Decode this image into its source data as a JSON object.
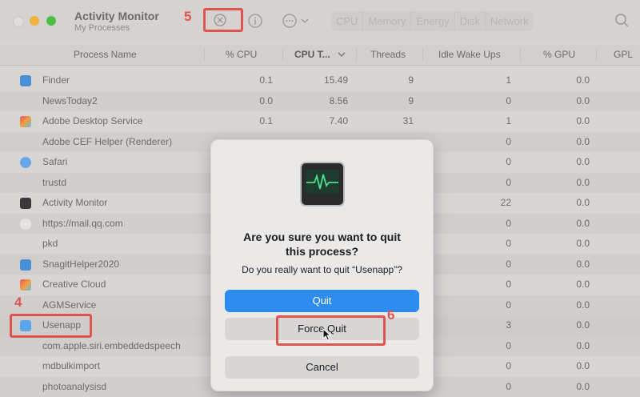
{
  "window": {
    "title": "Activity Monitor",
    "subtitle": "My Processes"
  },
  "toolbar": {
    "tabs": [
      "CPU",
      "Memory",
      "Energy",
      "Disk",
      "Network"
    ],
    "stop_icon": "stop-process-icon",
    "info_icon": "info-icon",
    "more_icon": "ellipsis-icon",
    "search_icon": "search-icon"
  },
  "table": {
    "columns": [
      "Process Name",
      "% CPU",
      "CPU T...",
      "Threads",
      "Idle Wake Ups",
      "% GPU",
      "GPL"
    ],
    "rows": [
      {
        "name": "Finder",
        "cpu": "0.1",
        "cpu_time": "15.49",
        "threads": "9",
        "idle": "1",
        "gpu": "0.0"
      },
      {
        "name": "NewsToday2",
        "cpu": "0.0",
        "cpu_time": "8.56",
        "threads": "9",
        "idle": "0",
        "gpu": "0.0"
      },
      {
        "name": "Adobe Desktop Service",
        "cpu": "0.1",
        "cpu_time": "7.40",
        "threads": "31",
        "idle": "1",
        "gpu": "0.0"
      },
      {
        "name": "Adobe CEF Helper (Renderer)",
        "cpu": "",
        "cpu_time": "",
        "threads": "",
        "idle": "0",
        "gpu": "0.0"
      },
      {
        "name": "Safari",
        "cpu": "",
        "cpu_time": "",
        "threads": "",
        "idle": "0",
        "gpu": "0.0"
      },
      {
        "name": "trustd",
        "cpu": "",
        "cpu_time": "",
        "threads": "",
        "idle": "0",
        "gpu": "0.0"
      },
      {
        "name": "Activity Monitor",
        "cpu": "",
        "cpu_time": "",
        "threads": "",
        "idle": "22",
        "gpu": "0.0"
      },
      {
        "name": "https://mail.qq.com",
        "cpu": "",
        "cpu_time": "",
        "threads": "",
        "idle": "0",
        "gpu": "0.0"
      },
      {
        "name": "pkd",
        "cpu": "",
        "cpu_time": "",
        "threads": "",
        "idle": "0",
        "gpu": "0.0"
      },
      {
        "name": "SnagitHelper2020",
        "cpu": "",
        "cpu_time": "",
        "threads": "",
        "idle": "0",
        "gpu": "0.0"
      },
      {
        "name": "Creative Cloud",
        "cpu": "",
        "cpu_time": "",
        "threads": "",
        "idle": "0",
        "gpu": "0.0"
      },
      {
        "name": "AGMService",
        "cpu": "",
        "cpu_time": "",
        "threads": "",
        "idle": "0",
        "gpu": "0.0"
      },
      {
        "name": "Usenapp",
        "cpu": "",
        "cpu_time": "",
        "threads": "",
        "idle": "3",
        "gpu": "0.0"
      },
      {
        "name": "com.apple.siri.embeddedspeech",
        "cpu": "",
        "cpu_time": "",
        "threads": "",
        "idle": "0",
        "gpu": "0.0"
      },
      {
        "name": "mdbulkimport",
        "cpu": "",
        "cpu_time": "",
        "threads": "",
        "idle": "0",
        "gpu": "0.0"
      },
      {
        "name": "photoanalysisd",
        "cpu": "",
        "cpu_time": "",
        "threads": "",
        "idle": "0",
        "gpu": "0.0"
      }
    ]
  },
  "dialog": {
    "icon": "activity-monitor-app-icon",
    "title_line1": "Are you sure you want to quit",
    "title_line2": "this process?",
    "message": "Do you really want to quit “Usenapp”?",
    "quit_label": "Quit",
    "force_quit_label": "Force Quit",
    "cancel_label": "Cancel"
  },
  "annotations": {
    "step4": "4",
    "step5": "5",
    "step6": "6",
    "color": "#e05450"
  },
  "colors": {
    "accent": "#2d8cf0",
    "window_bg": "#d9d5d5"
  }
}
